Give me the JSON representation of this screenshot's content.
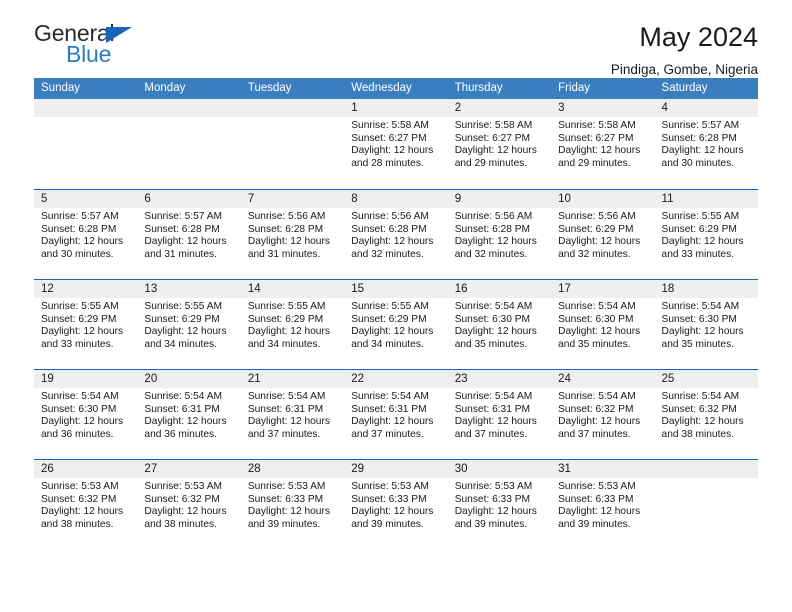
{
  "brand": {
    "name_part1": "General",
    "name_part2": "Blue",
    "accent_color": "#2a7bc4",
    "triangle_color": "#1565b4",
    "triangle_icon": "triangle-icon"
  },
  "header": {
    "title": "May 2024",
    "subtitle": "Pindiga, Gombe, Nigeria"
  },
  "calendar": {
    "header_bg": "#3b7ebf",
    "row_border_color": "#1565b4",
    "day_band_bg": "#efefef",
    "weekdays": [
      "Sunday",
      "Monday",
      "Tuesday",
      "Wednesday",
      "Thursday",
      "Friday",
      "Saturday"
    ],
    "weeks": [
      [
        {
          "day": "",
          "sunrise": "",
          "sunset": "",
          "daylight_line1": "",
          "daylight_line2": ""
        },
        {
          "day": "",
          "sunrise": "",
          "sunset": "",
          "daylight_line1": "",
          "daylight_line2": ""
        },
        {
          "day": "",
          "sunrise": "",
          "sunset": "",
          "daylight_line1": "",
          "daylight_line2": ""
        },
        {
          "day": "1",
          "sunrise": "Sunrise: 5:58 AM",
          "sunset": "Sunset: 6:27 PM",
          "daylight_line1": "Daylight: 12 hours",
          "daylight_line2": "and 28 minutes."
        },
        {
          "day": "2",
          "sunrise": "Sunrise: 5:58 AM",
          "sunset": "Sunset: 6:27 PM",
          "daylight_line1": "Daylight: 12 hours",
          "daylight_line2": "and 29 minutes."
        },
        {
          "day": "3",
          "sunrise": "Sunrise: 5:58 AM",
          "sunset": "Sunset: 6:27 PM",
          "daylight_line1": "Daylight: 12 hours",
          "daylight_line2": "and 29 minutes."
        },
        {
          "day": "4",
          "sunrise": "Sunrise: 5:57 AM",
          "sunset": "Sunset: 6:28 PM",
          "daylight_line1": "Daylight: 12 hours",
          "daylight_line2": "and 30 minutes."
        }
      ],
      [
        {
          "day": "5",
          "sunrise": "Sunrise: 5:57 AM",
          "sunset": "Sunset: 6:28 PM",
          "daylight_line1": "Daylight: 12 hours",
          "daylight_line2": "and 30 minutes."
        },
        {
          "day": "6",
          "sunrise": "Sunrise: 5:57 AM",
          "sunset": "Sunset: 6:28 PM",
          "daylight_line1": "Daylight: 12 hours",
          "daylight_line2": "and 31 minutes."
        },
        {
          "day": "7",
          "sunrise": "Sunrise: 5:56 AM",
          "sunset": "Sunset: 6:28 PM",
          "daylight_line1": "Daylight: 12 hours",
          "daylight_line2": "and 31 minutes."
        },
        {
          "day": "8",
          "sunrise": "Sunrise: 5:56 AM",
          "sunset": "Sunset: 6:28 PM",
          "daylight_line1": "Daylight: 12 hours",
          "daylight_line2": "and 32 minutes."
        },
        {
          "day": "9",
          "sunrise": "Sunrise: 5:56 AM",
          "sunset": "Sunset: 6:28 PM",
          "daylight_line1": "Daylight: 12 hours",
          "daylight_line2": "and 32 minutes."
        },
        {
          "day": "10",
          "sunrise": "Sunrise: 5:56 AM",
          "sunset": "Sunset: 6:29 PM",
          "daylight_line1": "Daylight: 12 hours",
          "daylight_line2": "and 32 minutes."
        },
        {
          "day": "11",
          "sunrise": "Sunrise: 5:55 AM",
          "sunset": "Sunset: 6:29 PM",
          "daylight_line1": "Daylight: 12 hours",
          "daylight_line2": "and 33 minutes."
        }
      ],
      [
        {
          "day": "12",
          "sunrise": "Sunrise: 5:55 AM",
          "sunset": "Sunset: 6:29 PM",
          "daylight_line1": "Daylight: 12 hours",
          "daylight_line2": "and 33 minutes."
        },
        {
          "day": "13",
          "sunrise": "Sunrise: 5:55 AM",
          "sunset": "Sunset: 6:29 PM",
          "daylight_line1": "Daylight: 12 hours",
          "daylight_line2": "and 34 minutes."
        },
        {
          "day": "14",
          "sunrise": "Sunrise: 5:55 AM",
          "sunset": "Sunset: 6:29 PM",
          "daylight_line1": "Daylight: 12 hours",
          "daylight_line2": "and 34 minutes."
        },
        {
          "day": "15",
          "sunrise": "Sunrise: 5:55 AM",
          "sunset": "Sunset: 6:29 PM",
          "daylight_line1": "Daylight: 12 hours",
          "daylight_line2": "and 34 minutes."
        },
        {
          "day": "16",
          "sunrise": "Sunrise: 5:54 AM",
          "sunset": "Sunset: 6:30 PM",
          "daylight_line1": "Daylight: 12 hours",
          "daylight_line2": "and 35 minutes."
        },
        {
          "day": "17",
          "sunrise": "Sunrise: 5:54 AM",
          "sunset": "Sunset: 6:30 PM",
          "daylight_line1": "Daylight: 12 hours",
          "daylight_line2": "and 35 minutes."
        },
        {
          "day": "18",
          "sunrise": "Sunrise: 5:54 AM",
          "sunset": "Sunset: 6:30 PM",
          "daylight_line1": "Daylight: 12 hours",
          "daylight_line2": "and 35 minutes."
        }
      ],
      [
        {
          "day": "19",
          "sunrise": "Sunrise: 5:54 AM",
          "sunset": "Sunset: 6:30 PM",
          "daylight_line1": "Daylight: 12 hours",
          "daylight_line2": "and 36 minutes."
        },
        {
          "day": "20",
          "sunrise": "Sunrise: 5:54 AM",
          "sunset": "Sunset: 6:31 PM",
          "daylight_line1": "Daylight: 12 hours",
          "daylight_line2": "and 36 minutes."
        },
        {
          "day": "21",
          "sunrise": "Sunrise: 5:54 AM",
          "sunset": "Sunset: 6:31 PM",
          "daylight_line1": "Daylight: 12 hours",
          "daylight_line2": "and 37 minutes."
        },
        {
          "day": "22",
          "sunrise": "Sunrise: 5:54 AM",
          "sunset": "Sunset: 6:31 PM",
          "daylight_line1": "Daylight: 12 hours",
          "daylight_line2": "and 37 minutes."
        },
        {
          "day": "23",
          "sunrise": "Sunrise: 5:54 AM",
          "sunset": "Sunset: 6:31 PM",
          "daylight_line1": "Daylight: 12 hours",
          "daylight_line2": "and 37 minutes."
        },
        {
          "day": "24",
          "sunrise": "Sunrise: 5:54 AM",
          "sunset": "Sunset: 6:32 PM",
          "daylight_line1": "Daylight: 12 hours",
          "daylight_line2": "and 37 minutes."
        },
        {
          "day": "25",
          "sunrise": "Sunrise: 5:54 AM",
          "sunset": "Sunset: 6:32 PM",
          "daylight_line1": "Daylight: 12 hours",
          "daylight_line2": "and 38 minutes."
        }
      ],
      [
        {
          "day": "26",
          "sunrise": "Sunrise: 5:53 AM",
          "sunset": "Sunset: 6:32 PM",
          "daylight_line1": "Daylight: 12 hours",
          "daylight_line2": "and 38 minutes."
        },
        {
          "day": "27",
          "sunrise": "Sunrise: 5:53 AM",
          "sunset": "Sunset: 6:32 PM",
          "daylight_line1": "Daylight: 12 hours",
          "daylight_line2": "and 38 minutes."
        },
        {
          "day": "28",
          "sunrise": "Sunrise: 5:53 AM",
          "sunset": "Sunset: 6:33 PM",
          "daylight_line1": "Daylight: 12 hours",
          "daylight_line2": "and 39 minutes."
        },
        {
          "day": "29",
          "sunrise": "Sunrise: 5:53 AM",
          "sunset": "Sunset: 6:33 PM",
          "daylight_line1": "Daylight: 12 hours",
          "daylight_line2": "and 39 minutes."
        },
        {
          "day": "30",
          "sunrise": "Sunrise: 5:53 AM",
          "sunset": "Sunset: 6:33 PM",
          "daylight_line1": "Daylight: 12 hours",
          "daylight_line2": "and 39 minutes."
        },
        {
          "day": "31",
          "sunrise": "Sunrise: 5:53 AM",
          "sunset": "Sunset: 6:33 PM",
          "daylight_line1": "Daylight: 12 hours",
          "daylight_line2": "and 39 minutes."
        },
        {
          "day": "",
          "sunrise": "",
          "sunset": "",
          "daylight_line1": "",
          "daylight_line2": ""
        }
      ]
    ]
  }
}
